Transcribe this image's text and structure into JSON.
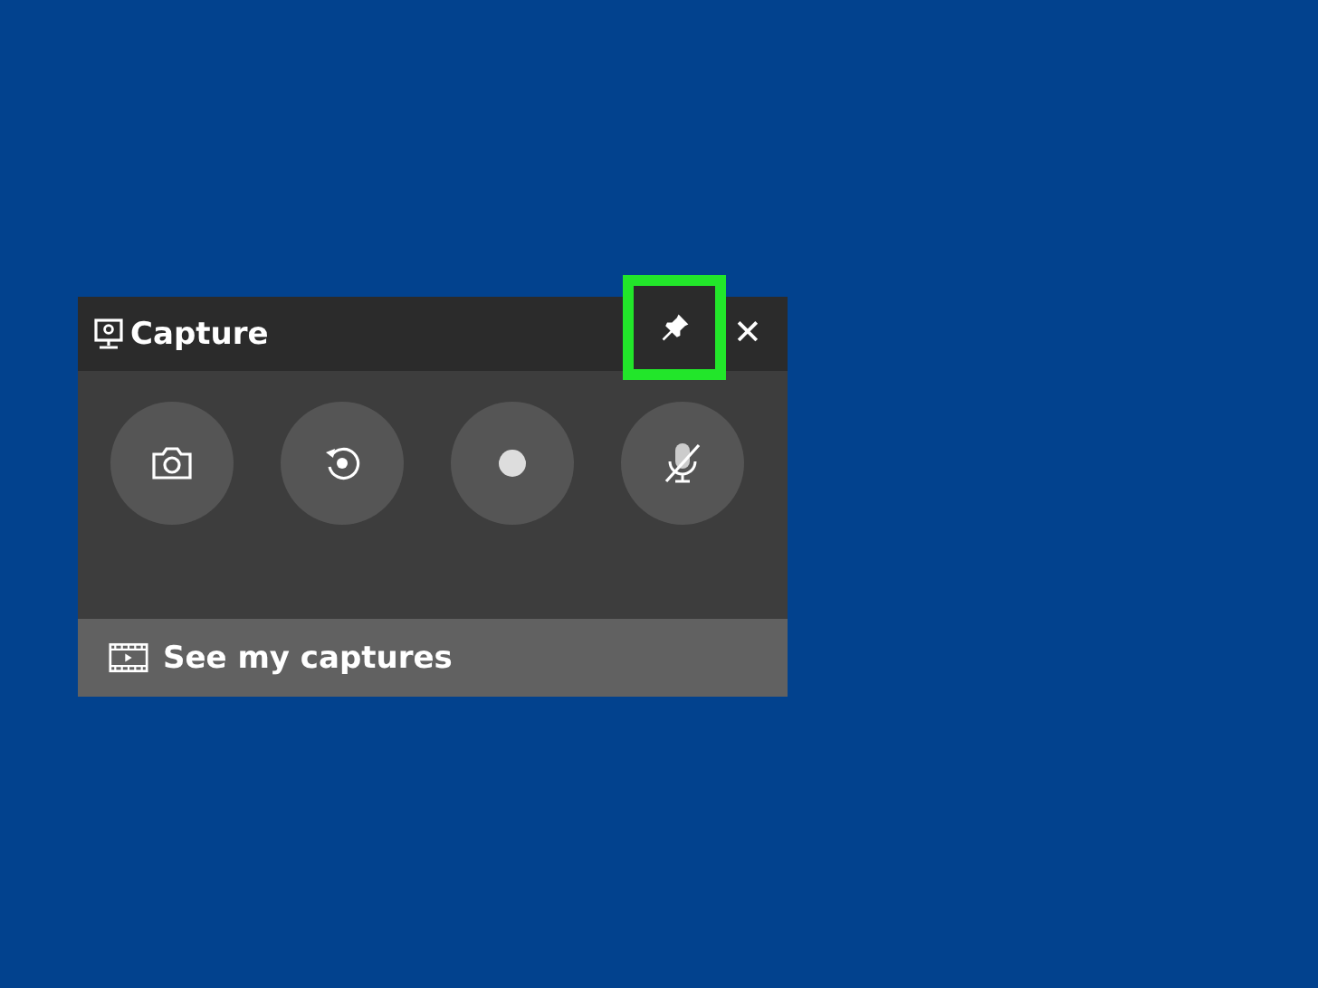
{
  "window": {
    "title": "Capture"
  },
  "title_bar": {
    "pin": {
      "highlighted": true
    },
    "close": "✕"
  },
  "buttons": [
    {
      "kind": "screenshot"
    },
    {
      "kind": "record_last"
    },
    {
      "kind": "record"
    },
    {
      "kind": "microphone",
      "muted": true
    }
  ],
  "footer": {
    "label": "See my captures"
  }
}
